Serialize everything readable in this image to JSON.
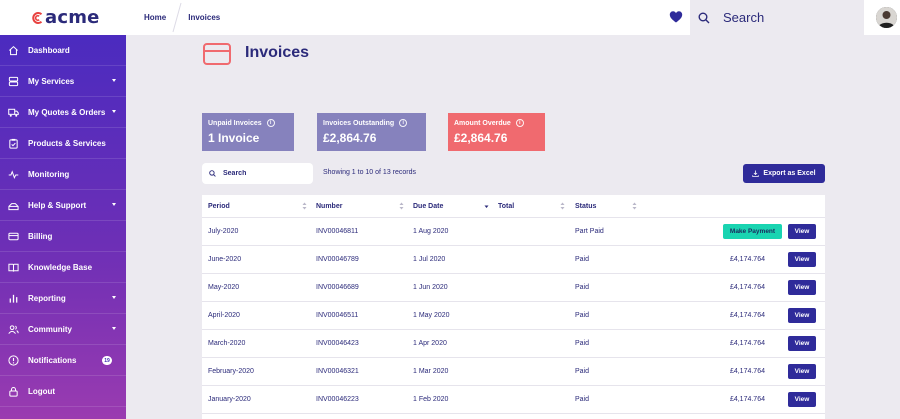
{
  "app": {
    "brand": "acme"
  },
  "breadcrumb": {
    "home": "Home",
    "current": "Invoices"
  },
  "header": {
    "search_placeholder": "Search"
  },
  "sidebar": {
    "items": [
      {
        "label": "Dashboard",
        "icon": "home-icon",
        "has_caret": false
      },
      {
        "label": "My Services",
        "icon": "server-icon",
        "has_caret": true
      },
      {
        "label": "My Quotes & Orders",
        "icon": "truck-icon",
        "has_caret": true
      },
      {
        "label": "Products & Services",
        "icon": "clipboard-icon",
        "has_caret": false
      },
      {
        "label": "Monitoring",
        "icon": "pulse-icon",
        "has_caret": false
      },
      {
        "label": "Help & Support",
        "icon": "support-icon",
        "has_caret": true
      },
      {
        "label": "Billing",
        "icon": "card-icon",
        "has_caret": false
      },
      {
        "label": "Knowledge Base",
        "icon": "book-icon",
        "has_caret": false
      },
      {
        "label": "Reporting",
        "icon": "bar-chart-icon",
        "has_caret": true
      },
      {
        "label": "Community",
        "icon": "users-icon",
        "has_caret": true
      },
      {
        "label": "Notifications",
        "icon": "bell-icon",
        "has_caret": false,
        "badge": "19"
      },
      {
        "label": "Logout",
        "icon": "lock-icon",
        "has_caret": false
      }
    ]
  },
  "page": {
    "title": "Invoices",
    "icon": "credit-card-icon"
  },
  "summary": {
    "unpaid_label": "Unpaid Invoices",
    "unpaid_value": "1 Invoice",
    "outstanding_label": "Invoices Outstanding",
    "outstanding_value": "£2,864.76",
    "overdue_label": "Amount Overdue",
    "overdue_value": "£2,864.76"
  },
  "table_controls": {
    "search_placeholder": "Search",
    "showing": "Showing 1 to 10 of 13 records",
    "export_label": "Export as Excel"
  },
  "table": {
    "columns": [
      "Period",
      "Number",
      "Due Date",
      "Total",
      "Status"
    ],
    "rows": [
      {
        "period": "July-2020",
        "number": "INV00046811",
        "due": "1 Aug 2020",
        "total": "£4,174.764",
        "status": "Part Paid",
        "pay": "Make Payment",
        "view": "View"
      },
      {
        "period": "June-2020",
        "number": "INV00046789",
        "due": "1 Jul 2020",
        "total": "£4,174.764",
        "status": "Paid",
        "view": "View"
      },
      {
        "period": "May-2020",
        "number": "INV00046689",
        "due": "1 Jun 2020",
        "total": "£4,174.764",
        "status": "Paid",
        "view": "View"
      },
      {
        "period": "April-2020",
        "number": "INV00046511",
        "due": "1 May 2020",
        "total": "£4,174.764",
        "status": "Paid",
        "view": "View"
      },
      {
        "period": "March-2020",
        "number": "INV00046423",
        "due": "1 Apr 2020",
        "total": "£4,174.764",
        "status": "Paid",
        "view": "View"
      },
      {
        "period": "February-2020",
        "number": "INV00046321",
        "due": "1 Mar 2020",
        "total": "£4,174.764",
        "status": "Paid",
        "view": "View"
      },
      {
        "period": "January-2020",
        "number": "INV00046223",
        "due": "1 Feb 2020",
        "total": "£4,174.764",
        "status": "Paid",
        "view": "View"
      }
    ]
  },
  "colors": {
    "accent": "#2f2b9a",
    "brand_red": "#e8413f",
    "pay_button": "#19d4b1",
    "overdue": "#f06a6f",
    "summary_card": "#8682bd"
  }
}
